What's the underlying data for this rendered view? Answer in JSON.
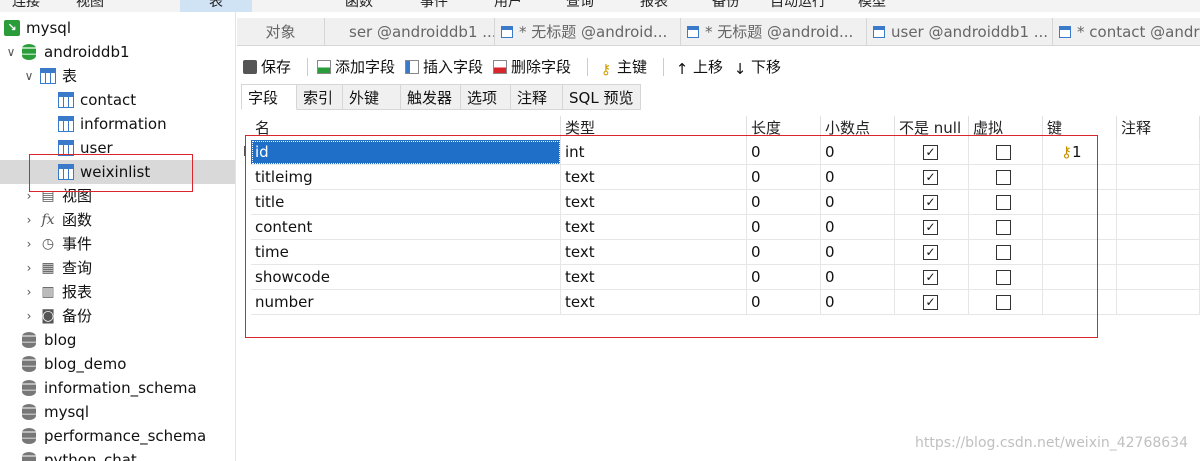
{
  "menubar": {
    "items": [
      "连接",
      "视图",
      "表",
      "视图",
      "函数",
      "事件",
      "用户",
      "查询",
      "报表",
      "备份",
      "自动运行",
      "模型"
    ]
  },
  "sidebar": {
    "tree": [
      {
        "label": "mysql",
        "icon": "connection-icon"
      },
      {
        "label": "androiddb1",
        "icon": "database-icon"
      },
      {
        "label": "表",
        "icon": "tables-folder-icon"
      },
      {
        "label": "contact",
        "icon": "table-icon"
      },
      {
        "label": "information",
        "icon": "table-icon"
      },
      {
        "label": "user",
        "icon": "table-icon"
      },
      {
        "label": "weixinlist",
        "icon": "table-icon"
      },
      {
        "label": "视图",
        "icon": "views-icon"
      },
      {
        "label": "函数",
        "icon": "function-icon"
      },
      {
        "label": "事件",
        "icon": "event-icon"
      },
      {
        "label": "查询",
        "icon": "query-icon"
      },
      {
        "label": "报表",
        "icon": "report-icon"
      },
      {
        "label": "备份",
        "icon": "backup-icon"
      },
      {
        "label": "blog",
        "icon": "database-icon"
      },
      {
        "label": "blog_demo",
        "icon": "database-icon"
      },
      {
        "label": "information_schema",
        "icon": "database-icon"
      },
      {
        "label": "mysql",
        "icon": "database-icon"
      },
      {
        "label": "performance_schema",
        "icon": "database-icon"
      },
      {
        "label": "python_chat",
        "icon": "database-icon"
      }
    ],
    "fx_glyph": "fx"
  },
  "tabs": [
    {
      "label": "对象"
    },
    {
      "label": "ser @androiddb1 ..."
    },
    {
      "label": "* 无标题 @android..."
    },
    {
      "label": "* 无标题 @android..."
    },
    {
      "label": "user @androiddb1 ..."
    },
    {
      "label": "* contact @andro"
    }
  ],
  "toolbar": {
    "save": "保存",
    "add_field": "添加字段",
    "insert_field": "插入字段",
    "delete_field": "删除字段",
    "primary_key": "主键",
    "move_up": "上移",
    "move_down": "下移"
  },
  "subtabs": [
    "字段",
    "索引",
    "外键",
    "触发器",
    "选项",
    "注释",
    "SQL 预览"
  ],
  "grid": {
    "columns": [
      "名",
      "类型",
      "长度",
      "小数点",
      "不是 null",
      "虚拟",
      "键",
      "注释"
    ],
    "rows": [
      {
        "name": "id",
        "type": "int",
        "length": "0",
        "decimals": "0",
        "not_null": true,
        "virtual": false,
        "key": "1"
      },
      {
        "name": "titleimg",
        "type": "text",
        "length": "0",
        "decimals": "0",
        "not_null": true,
        "virtual": false,
        "key": ""
      },
      {
        "name": "title",
        "type": "text",
        "length": "0",
        "decimals": "0",
        "not_null": true,
        "virtual": false,
        "key": ""
      },
      {
        "name": "content",
        "type": "text",
        "length": "0",
        "decimals": "0",
        "not_null": true,
        "virtual": false,
        "key": ""
      },
      {
        "name": "time",
        "type": "text",
        "length": "0",
        "decimals": "0",
        "not_null": true,
        "virtual": false,
        "key": ""
      },
      {
        "name": "showcode",
        "type": "text",
        "length": "0",
        "decimals": "0",
        "not_null": true,
        "virtual": false,
        "key": ""
      },
      {
        "name": "number",
        "type": "text",
        "length": "0",
        "decimals": "0",
        "not_null": true,
        "virtual": false,
        "key": ""
      }
    ],
    "row_marker": "I",
    "checkmark": "✓",
    "key_icon": "key-icon"
  },
  "watermark": "https://blog.csdn.net/weixin_42768634",
  "colors": {
    "selection": "#1f6fc8",
    "annotation_box": "#d8262c",
    "db_icon_active": "#2a9d3a"
  }
}
